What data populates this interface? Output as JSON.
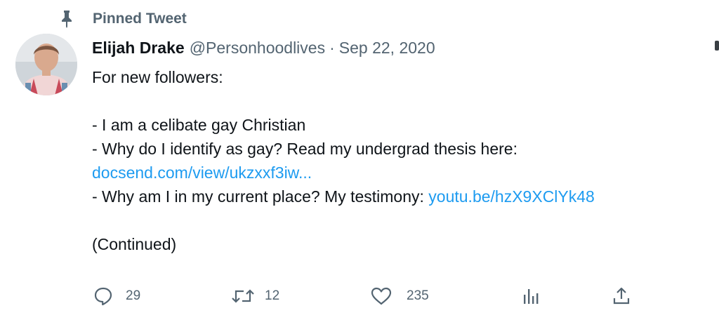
{
  "pinned": {
    "label": "Pinned Tweet",
    "icon": "pin-icon"
  },
  "author": {
    "name": "Elijah Drake",
    "handle": "@Personhoodlives",
    "separator": "·",
    "date": "Sep 22, 2020"
  },
  "body": {
    "line1": "For new followers:",
    "line2": "- I am a celibate gay Christian",
    "line3": "- Why do I identify as gay? Read my undergrad thesis here:",
    "link1": "docsend.com/view/ukzxxf3iw...",
    "line5_text": "- Why am I in my current place? My testimony: ",
    "link2": "youtu.be/hzX9XClYk48",
    "line6": "(Continued)"
  },
  "actions": {
    "reply": {
      "icon": "reply-icon",
      "count": "29"
    },
    "retweet": {
      "icon": "retweet-icon",
      "count": "12"
    },
    "like": {
      "icon": "heart-icon",
      "count": "235"
    },
    "views": {
      "icon": "analytics-icon"
    },
    "share": {
      "icon": "share-icon"
    }
  },
  "colors": {
    "link": "#1d9bf0",
    "secondary_text": "#536471",
    "primary_text": "#0f1419"
  }
}
